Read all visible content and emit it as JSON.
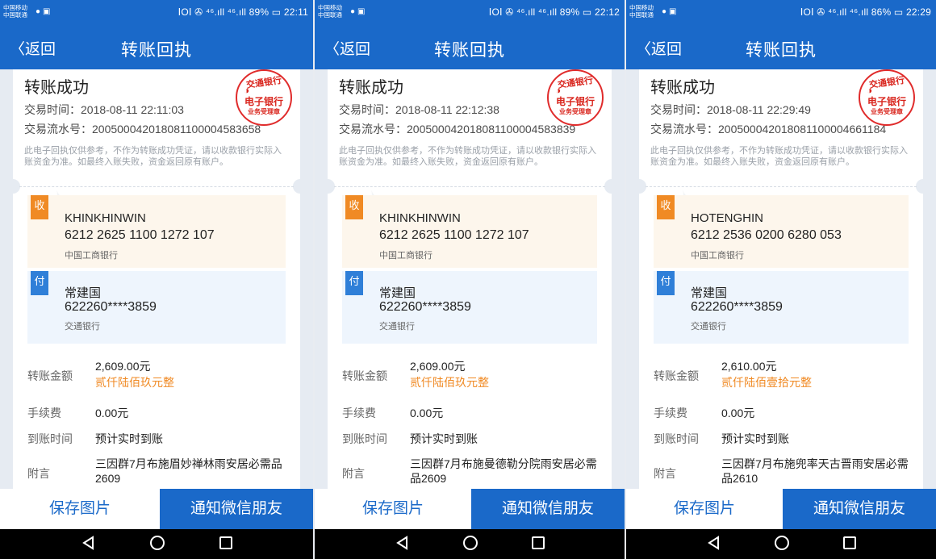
{
  "colors": {
    "primary": "#1a69c9",
    "accent": "#f08a24",
    "stamp": "#e02b2b"
  },
  "icons": {
    "payee_tag": "收",
    "payer_tag": "付"
  },
  "screens": [
    {
      "status": {
        "carrier_1": "中国移动",
        "carrier_2": "中国联通",
        "right": "ⅠOⅠ ✇ ⁴⁶.ıll ⁴⁶.ıll 89% ▭ 22:11"
      },
      "nav": {
        "back": "〈返回",
        "title": "转账回执"
      },
      "receipt": {
        "title": "转账成功",
        "time": "交易时间：2018-08-11 22:11:03",
        "serial": "交易流水号：200500042018081100004583658",
        "notice": "此电子回执仅供参考，不作为转账成功凭证，请以收款银行实际入账资金为准。如最终入账失败，资金返回原有账户。",
        "stamp": {
          "arc": "交通银行",
          "main": "电子银行",
          "sub": "业务受理章"
        },
        "payee": {
          "name": "KHINKHINWIN",
          "account": "6212 2625 1100 1272 107",
          "bank": "中国工商银行"
        },
        "payer": {
          "name": "常建国",
          "account": "622260****3859",
          "bank": "交通银行"
        },
        "details": {
          "amount_label": "转账金额",
          "amount": "2,609.00元",
          "amount_cn": "贰仟陆佰玖元整",
          "fee_label": "手续费",
          "fee": "0.00元",
          "arrival_label": "到账时间",
          "arrival": "预计实时到账",
          "remark_label": "附言",
          "remark": "三因群7月布施眉妙禅林雨安居必需品2609"
        }
      },
      "actions": {
        "save": "保存图片",
        "notify": "通知微信朋友"
      }
    },
    {
      "status": {
        "carrier_1": "中国移动",
        "carrier_2": "中国联通",
        "right": "ⅠOⅠ ✇ ⁴⁶.ıll ⁴⁶.ıll 89% ▭ 22:12"
      },
      "nav": {
        "back": "〈返回",
        "title": "转账回执"
      },
      "receipt": {
        "title": "转账成功",
        "time": "交易时间：2018-08-11 22:12:38",
        "serial": "交易流水号：200500042018081100004583839",
        "notice": "此电子回执仅供参考，不作为转账成功凭证，请以收款银行实际入账资金为准。如最终入账失败，资金返回原有账户。",
        "stamp": {
          "arc": "交通银行",
          "main": "电子银行",
          "sub": "业务受理章"
        },
        "payee": {
          "name": "KHINKHINWIN",
          "account": "6212 2625 1100 1272 107",
          "bank": "中国工商银行"
        },
        "payer": {
          "name": "常建国",
          "account": "622260****3859",
          "bank": "交通银行"
        },
        "details": {
          "amount_label": "转账金额",
          "amount": "2,609.00元",
          "amount_cn": "贰仟陆佰玖元整",
          "fee_label": "手续费",
          "fee": "0.00元",
          "arrival_label": "到账时间",
          "arrival": "预计实时到账",
          "remark_label": "附言",
          "remark": "三因群7月布施曼德勒分院雨安居必需品2609"
        }
      },
      "actions": {
        "save": "保存图片",
        "notify": "通知微信朋友"
      }
    },
    {
      "status": {
        "carrier_1": "中国移动",
        "carrier_2": "中国联通",
        "right": "ⅠOⅠ ✇ ⁴⁶.ıll ⁴⁶.ıll 86% ▭ 22:29"
      },
      "nav": {
        "back": "〈返回",
        "title": "转账回执"
      },
      "receipt": {
        "title": "转账成功",
        "time": "交易时间：2018-08-11 22:29:49",
        "serial": "交易流水号：200500042018081100004661184",
        "notice": "此电子回执仅供参考，不作为转账成功凭证，请以收款银行实际入账资金为准。如最终入账失败，资金返回原有账户。",
        "stamp": {
          "arc": "交通银行",
          "main": "电子银行",
          "sub": "业务受理章"
        },
        "payee": {
          "name": "HOTENGHIN",
          "account": "6212 2536 0200 6280 053",
          "bank": "中国工商银行"
        },
        "payer": {
          "name": "常建国",
          "account": "622260****3859",
          "bank": "交通银行"
        },
        "details": {
          "amount_label": "转账金额",
          "amount": "2,610.00元",
          "amount_cn": "贰仟陆佰壹拾元整",
          "fee_label": "手续费",
          "fee": "0.00元",
          "arrival_label": "到账时间",
          "arrival": "预计实时到账",
          "remark_label": "附言",
          "remark": "三因群7月布施兜率天古晋雨安居必需品2610"
        }
      },
      "actions": {
        "save": "保存图片",
        "notify": "通知微信朋友"
      }
    }
  ]
}
